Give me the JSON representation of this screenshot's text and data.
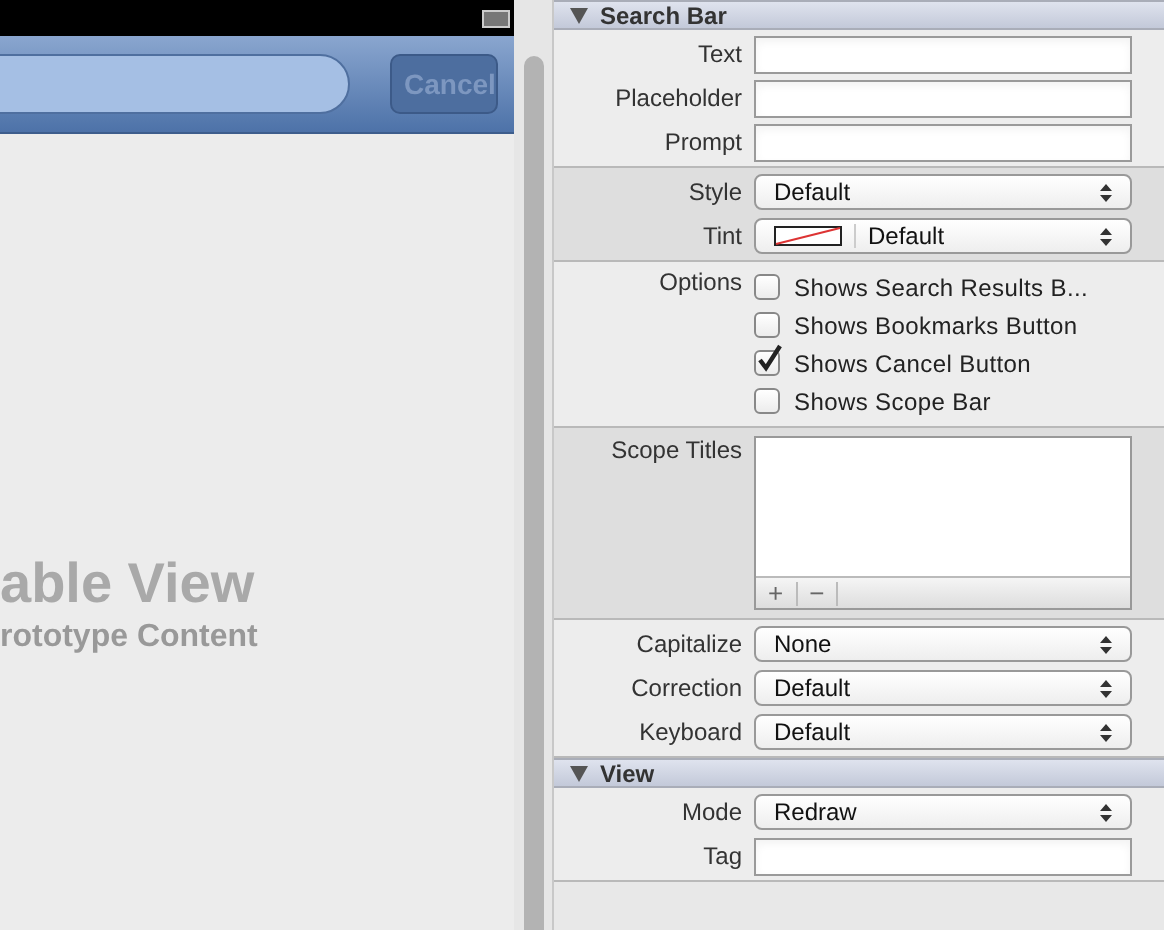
{
  "canvas": {
    "cancel_button": "Cancel",
    "table_view": {
      "title": "able View",
      "subtitle": "rototype Content"
    }
  },
  "inspector": {
    "sections": [
      {
        "title": "Search Bar",
        "expanded": true,
        "groups": [
          {
            "rows": [
              {
                "kind": "text",
                "label": "Text"
              },
              {
                "kind": "text",
                "label": "Placeholder"
              },
              {
                "kind": "text",
                "label": "Prompt"
              }
            ]
          },
          {
            "rows": [
              {
                "kind": "popup",
                "label": "Style",
                "value": "Default"
              },
              {
                "kind": "tint",
                "label": "Tint",
                "value": "Default"
              }
            ]
          },
          {
            "rows": [
              {
                "kind": "options",
                "label": "Options",
                "items": [
                  {
                    "label": "Shows Search Results B...",
                    "checked": false
                  },
                  {
                    "label": "Shows Bookmarks Button",
                    "checked": false
                  },
                  {
                    "label": "Shows Cancel Button",
                    "checked": true
                  },
                  {
                    "label": "Shows Scope Bar",
                    "checked": false
                  }
                ]
              }
            ]
          },
          {
            "rows": [
              {
                "kind": "list",
                "label": "Scope Titles",
                "add": "+",
                "remove": "−"
              }
            ]
          },
          {
            "rows": [
              {
                "kind": "popup",
                "label": "Capitalize",
                "value": "None"
              },
              {
                "kind": "popup",
                "label": "Correction",
                "value": "Default"
              },
              {
                "kind": "popup",
                "label": "Keyboard",
                "value": "Default"
              }
            ]
          }
        ]
      },
      {
        "title": "View",
        "expanded": true,
        "groups": [
          {
            "rows": [
              {
                "kind": "popup",
                "label": "Mode",
                "value": "Redraw"
              },
              {
                "kind": "text",
                "label": "Tag"
              }
            ]
          }
        ]
      }
    ]
  }
}
